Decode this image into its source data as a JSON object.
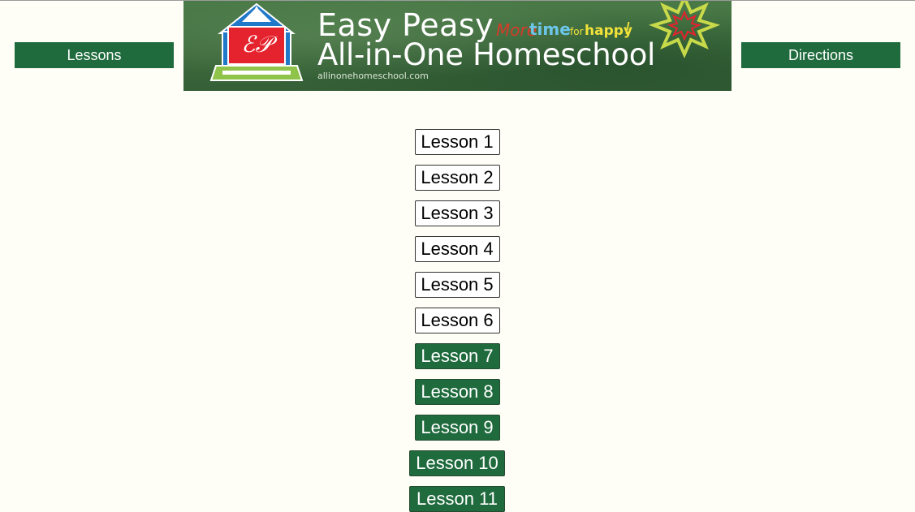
{
  "nav": {
    "left_label": "Lessons",
    "right_label": "Directions"
  },
  "banner": {
    "title_line1": "Easy Peasy",
    "title_line2": "All-in-One Homeschool",
    "url": "allinonehomeschool.com",
    "tagline": {
      "more": "More",
      "time": "time",
      "for": "for",
      "happy": "happy",
      "excl": "!"
    }
  },
  "lessons": [
    {
      "label": "Lesson 1",
      "style": "light"
    },
    {
      "label": "Lesson 2",
      "style": "light"
    },
    {
      "label": "Lesson 3",
      "style": "light"
    },
    {
      "label": "Lesson 4",
      "style": "light"
    },
    {
      "label": "Lesson 5",
      "style": "light"
    },
    {
      "label": "Lesson 6",
      "style": "light"
    },
    {
      "label": "Lesson 7",
      "style": "dark"
    },
    {
      "label": "Lesson 8",
      "style": "dark"
    },
    {
      "label": "Lesson 9",
      "style": "dark"
    },
    {
      "label": "Lesson 10",
      "style": "dark"
    },
    {
      "label": "Lesson 11",
      "style": "dark"
    }
  ],
  "colors": {
    "background": "#fefef6",
    "accent_green": "#1f6b3d",
    "banner_green": "#3f6b3e"
  }
}
